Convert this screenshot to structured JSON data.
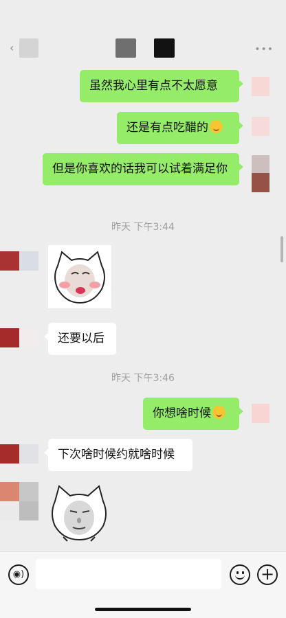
{
  "header": {
    "back_icon": "chevron-left-icon",
    "more_icon": "more-dots-icon"
  },
  "messages": [
    {
      "side": "out",
      "text": "虽然我心里有点不太愿意"
    },
    {
      "side": "out",
      "text": "还是有点吃醋的",
      "emoji": "blush-smile-emoji"
    },
    {
      "side": "out",
      "text": "但是你喜欢的话我可以试着满足你"
    },
    {
      "type": "timestamp",
      "text": "昨天 下午3:44"
    },
    {
      "side": "in",
      "type": "sticker",
      "sticker": "white-cat-pout-sticker"
    },
    {
      "side": "in",
      "text": "还要以后"
    },
    {
      "type": "timestamp",
      "text": "昨天 下午3:46"
    },
    {
      "side": "out",
      "text": "你想啥时候",
      "emoji": "laugh-cry-emoji"
    },
    {
      "side": "in",
      "text": "下次啥时候约就啥时候"
    },
    {
      "side": "in",
      "type": "sticker",
      "sticker": "cat-face-meme-sticker"
    }
  ],
  "colors": {
    "outgoing_bubble": "#95ec69",
    "incoming_bubble": "#ffffff",
    "background": "#ededed"
  },
  "input_bar": {
    "voice_icon": "voice-icon",
    "emoji_icon": "emoji-icon",
    "plus_icon": "plus-icon",
    "placeholder": ""
  }
}
